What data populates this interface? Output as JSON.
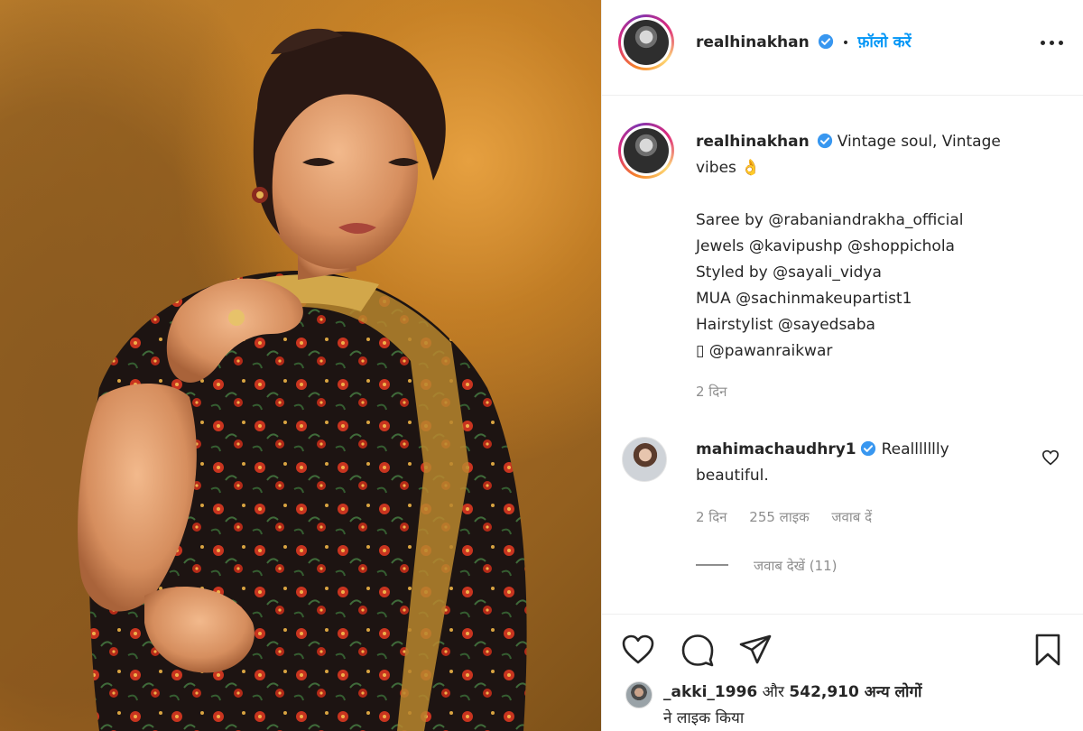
{
  "post": {
    "username": "realhinakhan",
    "follow_label": "फ़ॉलो करें",
    "dot": "•",
    "more_icon": "more-horizontal-icon"
  },
  "caption": {
    "username": "realhinakhan",
    "line1": "Vintage soul, Vintage",
    "line2": "vibes 👌",
    "credits": [
      "Saree by @rabaniandrakha_official",
      "Jewels @kavipushp @shoppichola",
      "Styled by @sayali_vidya",
      "MUA @sachinmakeupartist1",
      "Hairstylist @sayedsaba",
      "▯ @pawanraikwar"
    ],
    "time": "2 दिन"
  },
  "comment": {
    "username": "mahimachaudhry1",
    "text_line1": "Reallllllly",
    "text_line2": "beautiful.",
    "time": "2 दिन",
    "likes": "255 लाइक",
    "reply_label": "जवाब दें",
    "view_replies": "जवाब देखें (11)"
  },
  "likes": {
    "liker": "_akki_1996",
    "and": "और",
    "others": "542,910 अन्य लोगों",
    "suffix": "ने लाइक किया"
  },
  "colors": {
    "link": "#0095f6",
    "verified": "#3897f0",
    "secondary_text": "#8e8e8e",
    "primary_text": "#262626"
  }
}
